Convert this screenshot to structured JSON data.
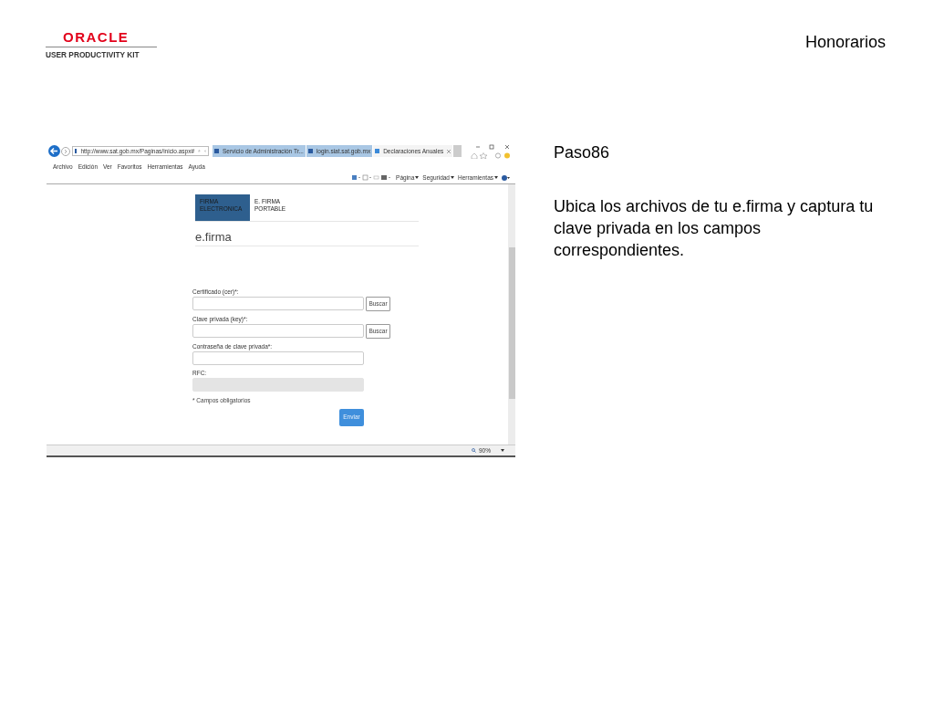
{
  "document": {
    "logo": {
      "brand": "ORACLE",
      "product": "USER PRODUCTIVITY KIT"
    },
    "title": "Honorarios",
    "step": "Paso86",
    "instruction": "Ubica los archivos de tu e.firma y captura tu clave privada en los campos correspondientes."
  },
  "browser": {
    "address": "http://www.sat.gob.mx/Paginas/inicio.aspx#",
    "tabs": [
      {
        "label": "Servicio de Administración Tr...",
        "selected": false
      },
      {
        "label": "login.siat.sat.gob.mx",
        "selected": false
      },
      {
        "label": "Declaraciones Anuales",
        "selected": true
      }
    ],
    "menu": [
      "Archivo",
      "Edición",
      "Ver",
      "Favoritos",
      "Herramientas",
      "Ayuda"
    ],
    "toolbar": [
      "Página",
      "Seguridad",
      "Herramientas"
    ],
    "zoom": "90%"
  },
  "page": {
    "tabs": [
      {
        "label": "FIRMA ELECTRONICA",
        "selected": true
      },
      {
        "label": "E. FIRMA PORTABLE",
        "selected": false
      }
    ],
    "heading": "e.firma",
    "fields": [
      {
        "kind": "file",
        "label": "Certificado (cer)*:",
        "button": "Buscar",
        "disabled": false
      },
      {
        "kind": "file",
        "label": "Clave privada (key)*:",
        "button": "Buscar",
        "disabled": false
      },
      {
        "kind": "text",
        "label": "Contraseña de clave privada*:",
        "disabled": false
      },
      {
        "kind": "text",
        "label": "RFC:",
        "disabled": true
      }
    ],
    "note": "* Campos obligatorios",
    "submit": "Enviar"
  }
}
